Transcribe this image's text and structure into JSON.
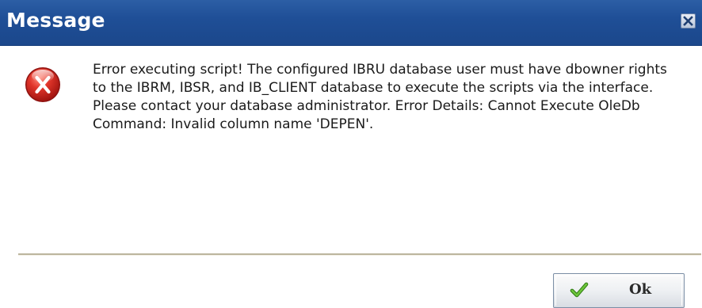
{
  "dialog": {
    "title": "Message",
    "close_icon": "close-icon",
    "error_icon": "error-x-icon",
    "message": "Error executing script! The configured IBRU database user must have dbowner rights to the IBRM, IBSR, and IB_CLIENT database to execute the scripts via the interface. Please contact your database administrator. Error Details: Cannot Execute OleDb Command: Invalid column name 'DEPEN'.",
    "ok_button": {
      "label": "Ok",
      "icon": "checkmark-icon"
    }
  },
  "colors": {
    "titlebar": "#1f4f97",
    "title_text": "#ffffff",
    "error_red": "#d42a22",
    "check_green": "#3f9b1f",
    "divider": "#bcb59e"
  }
}
